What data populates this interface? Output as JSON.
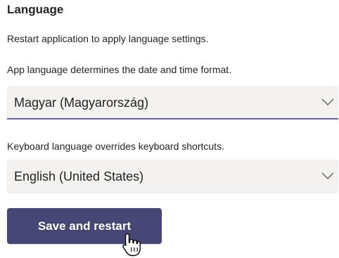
{
  "language": {
    "title": "Language",
    "restart_note": "Restart application to apply language settings.",
    "app_language_desc": "App language determines the date and time format.",
    "app_language_value": "Magyar (Magyarország)",
    "keyboard_language_desc": "Keyboard language overrides keyboard shortcuts.",
    "keyboard_language_value": "English (United States)",
    "save_button_label": "Save and restart"
  },
  "icons": {
    "dropdown": "chevron-down-icon",
    "cursor": "hand-pointer-icon"
  },
  "colors": {
    "accent": "#6264a7",
    "button": "#464775",
    "select_bg": "#f3f2f1",
    "text": "#252423"
  }
}
